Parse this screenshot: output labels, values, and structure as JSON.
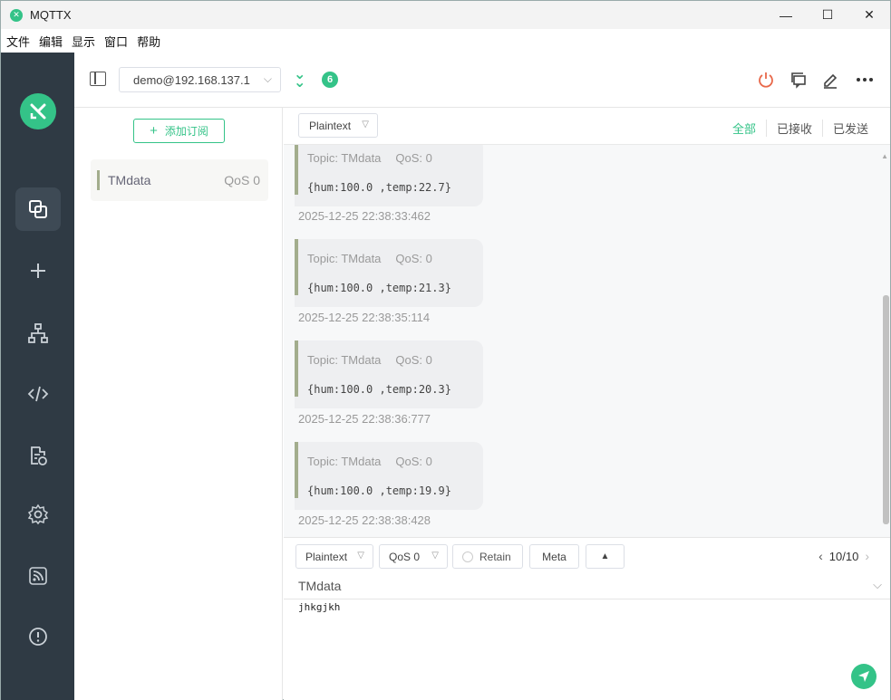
{
  "window": {
    "title": "MQTTX",
    "minimize": "—",
    "maximize": "☐",
    "close": "✕"
  },
  "menu": [
    "文件",
    "编辑",
    "显示",
    "窗口",
    "帮助"
  ],
  "connection": {
    "name": "demo@192.168.137.1",
    "count": "6"
  },
  "subscriptions": {
    "add_label": "添加订阅",
    "items": [
      {
        "topic": "TMdata",
        "qos": "QoS 0"
      }
    ]
  },
  "filter": {
    "payload_format": "Plaintext",
    "tabs": [
      "全部",
      "已接收",
      "已发送"
    ]
  },
  "messages": [
    {
      "topic_label": "Topic: TMdata",
      "qos_label": "QoS: 0",
      "payload": "{hum:100.0 ,temp:22.7}",
      "time": "2025-12-25 22:38:33:462"
    },
    {
      "topic_label": "Topic: TMdata",
      "qos_label": "QoS: 0",
      "payload": "{hum:100.0 ,temp:21.3}",
      "time": "2025-12-25 22:38:35:114"
    },
    {
      "topic_label": "Topic: TMdata",
      "qos_label": "QoS: 0",
      "payload": "{hum:100.0 ,temp:20.3}",
      "time": "2025-12-25 22:38:36:777"
    },
    {
      "topic_label": "Topic: TMdata",
      "qos_label": "QoS: 0",
      "payload": "{hum:100.0 ,temp:19.9}",
      "time": "2025-12-25 22:38:38:428"
    }
  ],
  "publish": {
    "payload_format": "Plaintext",
    "qos": "QoS 0",
    "retain_label": "Retain",
    "meta_label": "Meta",
    "pager": "10/10",
    "topic": "TMdata",
    "payload": "jhkgjkh"
  },
  "colors": {
    "accent": "#34c388",
    "nav_bg": "#2f3a44",
    "disconnect": "#e8684a"
  },
  "icons": {
    "nav": [
      "connections-icon",
      "plus-icon",
      "topology-icon",
      "script-icon",
      "log-icon",
      "settings-icon",
      "rss-icon",
      "info-icon"
    ],
    "toolbar": [
      "power-icon",
      "new-window-icon",
      "edit-icon",
      "more-icon"
    ]
  }
}
